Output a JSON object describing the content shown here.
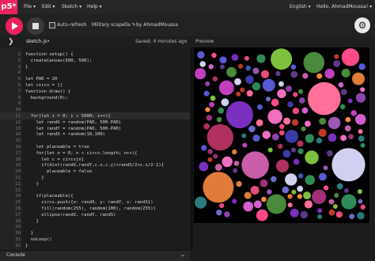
{
  "nav": {
    "logo": "p5*",
    "menu": [
      "File ▾",
      "Edit ▾",
      "Sketch ▾",
      "Help ▾"
    ],
    "language": "English ▾",
    "user": "Hello, AhmadMoussa! ▾"
  },
  "toolbar": {
    "auto_refresh": "Auto-refresh",
    "sketch_title": "Military scapella ✎",
    "author": "by AhmadMoussa"
  },
  "subbar": {
    "sidebar_toggle": "❯",
    "file_name": "sketch.js•",
    "saved": "Saved: 4 minutes ago",
    "preview": "Preview"
  },
  "editor": {
    "lines": [
      {
        "n": "1",
        "t": "function setup() {"
      },
      {
        "n": "2",
        "t": "  createCanvas(500, 500);"
      },
      {
        "n": "3",
        "t": "}"
      },
      {
        "n": "4",
        "t": ""
      },
      {
        "n": "5",
        "t": "let PAD = 20"
      },
      {
        "n": "6",
        "t": "let circs = []"
      },
      {
        "n": "7",
        "t": "function draw() {"
      },
      {
        "n": "8",
        "t": "  background(0);"
      },
      {
        "n": "9",
        "t": ""
      },
      {
        "n": "10",
        "t": ""
      },
      {
        "n": "11",
        "t": "  for(let i = 0; i < 5000; i++){"
      },
      {
        "n": "12",
        "t": "    let randX = random(PAD, 500-PAD)"
      },
      {
        "n": "13",
        "t": "    let randY = random(PAD, 500-PAD)"
      },
      {
        "n": "14",
        "t": "    let randS = random(10,100)"
      },
      {
        "n": "15",
        "t": ""
      },
      {
        "n": "16",
        "t": "    let placeable = true"
      },
      {
        "n": "17",
        "t": "    for(let n = 0; n < circs.length; n++){"
      },
      {
        "n": "18",
        "t": "      let c = circs[n]"
      },
      {
        "n": "19",
        "t": "      if(dist(randX,randY,c.x,c.y)<randS/2+c.s/2-1){"
      },
      {
        "n": "20",
        "t": "        placeable = false"
      },
      {
        "n": "21",
        "t": "      }"
      },
      {
        "n": "22",
        "t": "    }"
      },
      {
        "n": "23",
        "t": ""
      },
      {
        "n": "24",
        "t": "    if(placeable){"
      },
      {
        "n": "25",
        "t": "      circs.push({x: randX, y: randY, s: randS})"
      },
      {
        "n": "26",
        "t": "      fill(random(255), random(100), random(255))"
      },
      {
        "n": "27",
        "t": "      ellipse(randX, randY, randS)"
      },
      {
        "n": "28",
        "t": "    }"
      },
      {
        "n": "29",
        "t": ""
      },
      {
        "n": "30",
        "t": "  }"
      },
      {
        "n": "31",
        "t": "  noLoop()"
      },
      {
        "n": "32",
        "t": "}"
      }
    ]
  },
  "console": {
    "label": "Console",
    "toggle": "⌄"
  },
  "colors": {
    "accent": "#ed225d",
    "circles": [
      "#c0392b",
      "#7b2fbe",
      "#ff4a8a",
      "#3a3aa8",
      "#d45fd0",
      "#2c7a7b",
      "#9b59b6",
      "#e74c7c",
      "#5a5ad6",
      "#b03060",
      "#4a8a3c",
      "#e07b39",
      "#8e44ad",
      "#c95ea8",
      "#6b6bd0",
      "#ff6f9a",
      "#2e8b57",
      "#a0307a",
      "#d0d0f0",
      "#f06fc0",
      "#5b3a8a",
      "#ff8a3d",
      "#3d5ab0",
      "#bf3fbf",
      "#7fbf3f"
    ]
  }
}
